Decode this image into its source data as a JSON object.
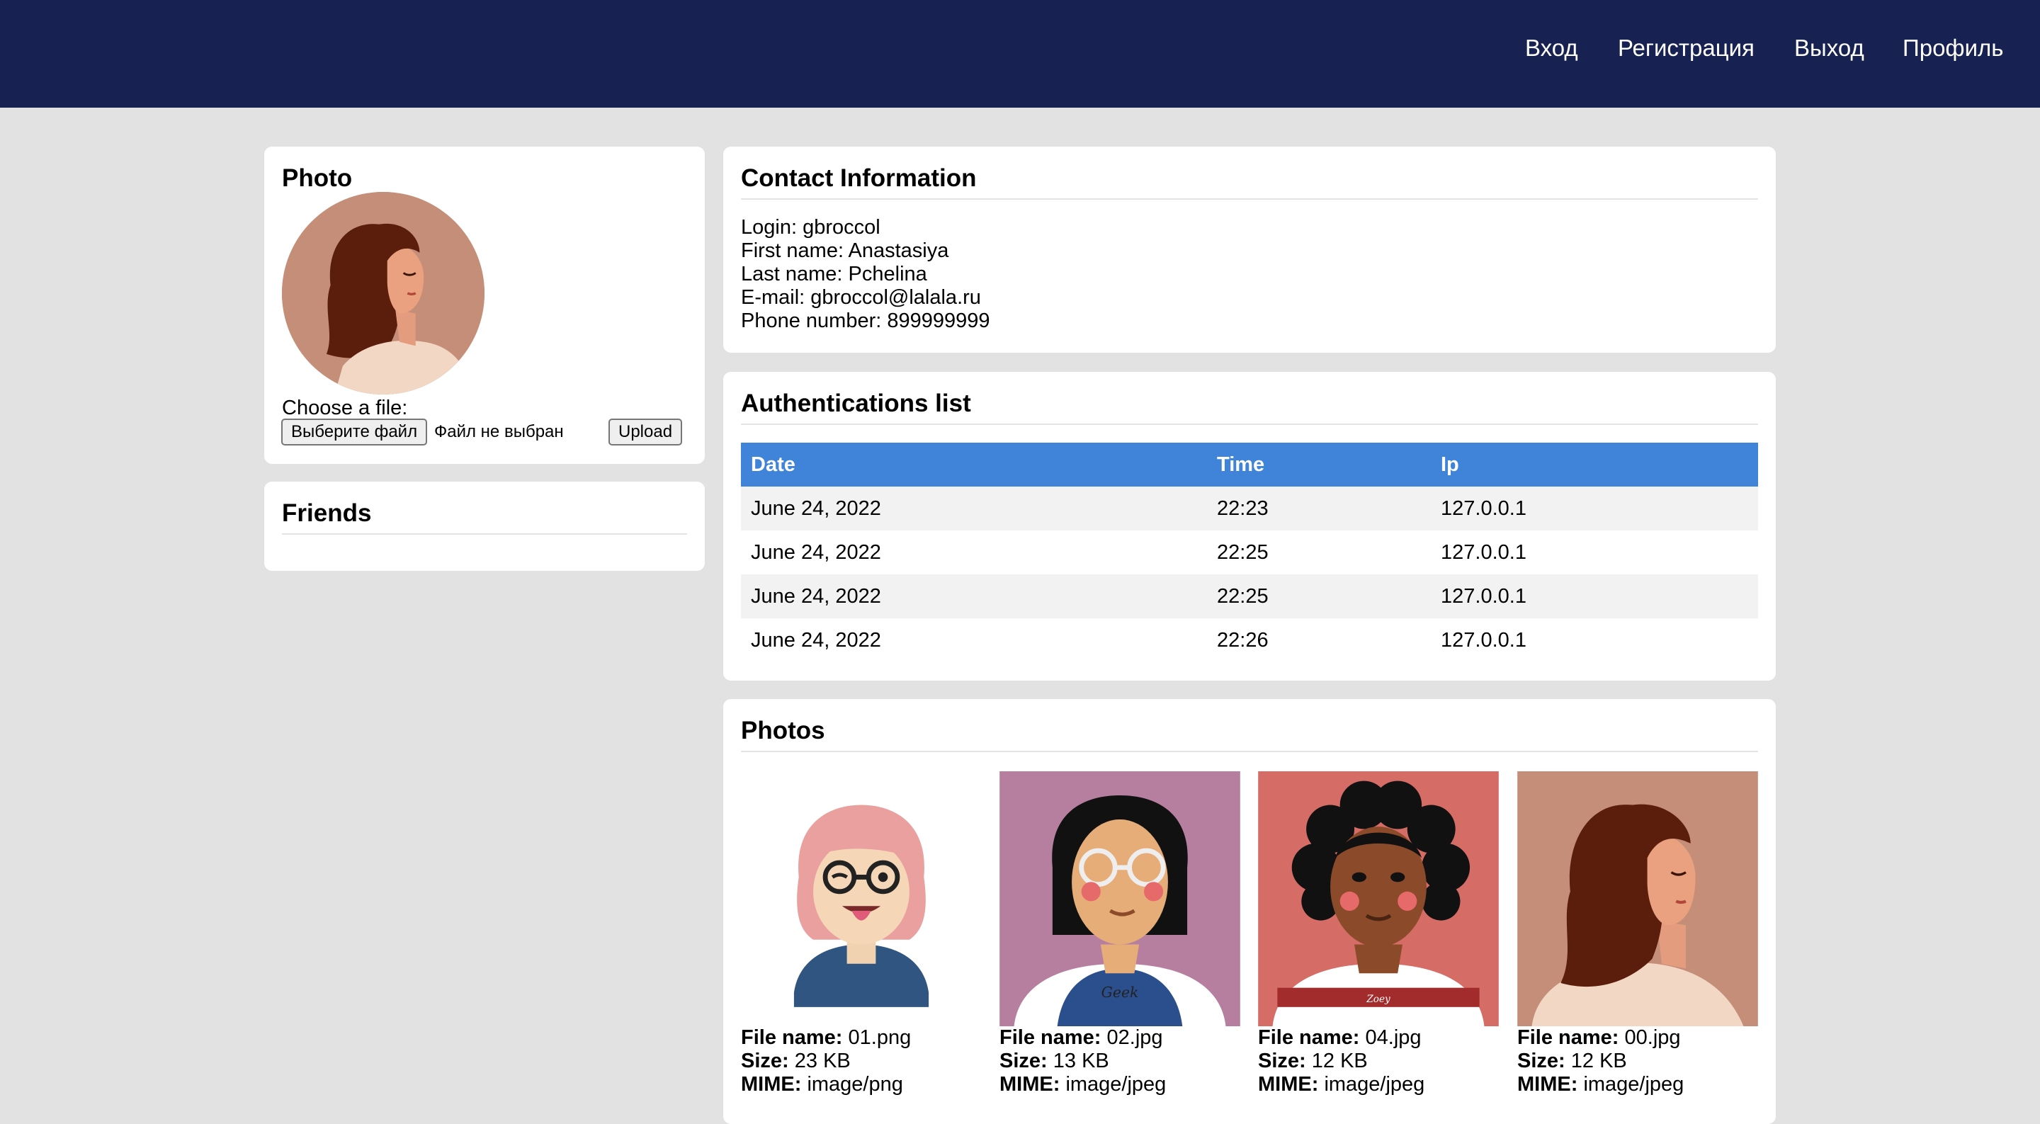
{
  "nav": {
    "links": [
      "Вход",
      "Регистрация",
      "Выход",
      "Профиль"
    ]
  },
  "photo_card": {
    "title": "Photo",
    "choose_label": "Choose a file:",
    "choose_button": "Выберите файл",
    "no_file": "Файл не выбран",
    "upload_button": "Upload"
  },
  "friends_card": {
    "title": "Friends"
  },
  "contact": {
    "title": "Contact Information",
    "login_label": "Login:",
    "login": "gbroccol",
    "first_name_label": "First name:",
    "first_name": "Anastasiya",
    "last_name_label": "Last name:",
    "last_name": "Pchelina",
    "email_label": "E-mail:",
    "email": "gbroccol@lalala.ru",
    "phone_label": "Phone number:",
    "phone": "899999999"
  },
  "auth": {
    "title": "Authentications list",
    "columns": [
      "Date",
      "Time",
      "Ip"
    ],
    "rows": [
      [
        "June 24, 2022",
        "22:23",
        "127.0.0.1"
      ],
      [
        "June 24, 2022",
        "22:25",
        "127.0.0.1"
      ],
      [
        "June 24, 2022",
        "22:25",
        "127.0.0.1"
      ],
      [
        "June 24, 2022",
        "22:26",
        "127.0.0.1"
      ]
    ]
  },
  "photos": {
    "title": "Photos",
    "labels": {
      "file_name": "File name:",
      "size": "Size:",
      "mime": "MIME:"
    },
    "items": [
      {
        "file_name": "01.png",
        "size": "23 KB",
        "mime": "image/png",
        "shirt_text": ""
      },
      {
        "file_name": "02.jpg",
        "size": "13 KB",
        "mime": "image/jpeg",
        "shirt_text": "Geek"
      },
      {
        "file_name": "04.jpg",
        "size": "12 KB",
        "mime": "image/jpeg",
        "shirt_text": "Zoey"
      },
      {
        "file_name": "00.jpg",
        "size": "12 KB",
        "mime": "image/jpeg",
        "shirt_text": ""
      }
    ]
  },
  "colors": {
    "navbar": "#172253",
    "page_bg": "#e2e2e2",
    "table_header": "#3f84d8"
  }
}
